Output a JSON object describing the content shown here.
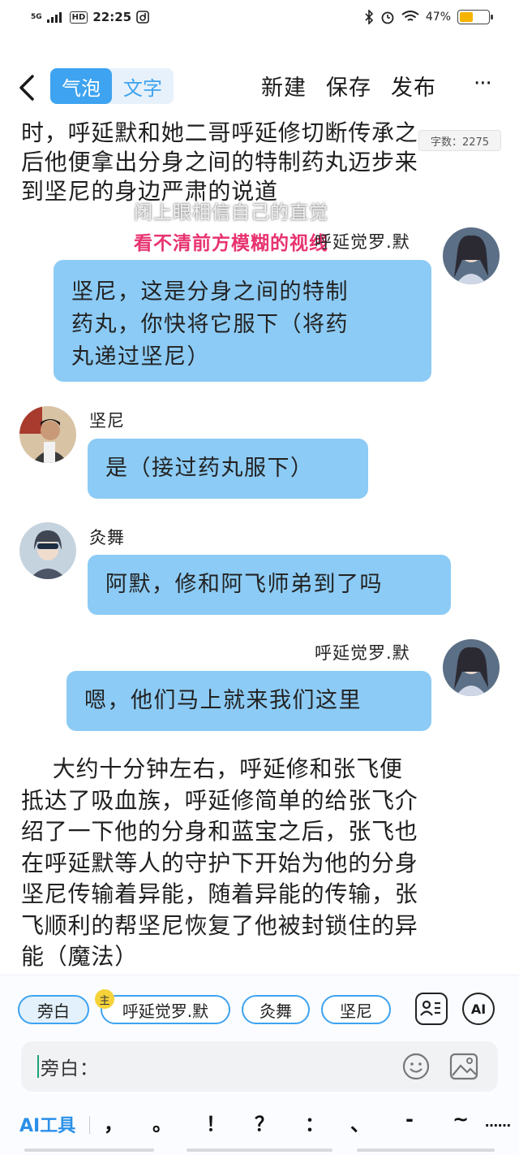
{
  "status": {
    "network": "5G",
    "hd": "HD",
    "time": "22:25",
    "battery_text": "47%",
    "battery_level": 0.47
  },
  "toolbar": {
    "mode_bubble": "气泡",
    "mode_text": "文字",
    "new_label": "新建",
    "save_label": "保存",
    "publish_label": "发布",
    "more_label": "···"
  },
  "story": {
    "narration_top_lines": [
      "时，呼延默和她二哥呼延修切断传承之",
      "后他便拿出分身之间的特制药丸迈步来",
      "到坚尼的身边严肃的说道"
    ],
    "char_count": "字数：2275",
    "lyrics": [
      "闭上眼相信自己的直觉",
      "看不清前方模糊的视线"
    ],
    "messages": [
      {
        "speaker": "呼延觉罗.默",
        "text_lines": [
          "坚尼，这是分身之间的特制",
          "药丸，你快将它服下（将药",
          "丸递过坚尼）"
        ]
      },
      {
        "speaker": "坚尼",
        "text_lines": [
          "是（接过药丸服下）"
        ]
      },
      {
        "speaker": "灸舞",
        "text_lines": [
          "阿默，修和阿飞师弟到了吗"
        ]
      },
      {
        "speaker": "呼延觉罗.默",
        "text_lines": [
          "嗯，他们马上就来我们这里"
        ]
      }
    ],
    "narration_bottom_lines": [
      "    大约十分钟左右，呼延修和张飞便",
      "抵达了吸血族，呼延修简单的给张飞介",
      "绍了一下他的分身和蓝宝之后，张飞也",
      "在呼延默等人的守护下开始为他的分身",
      "坚尼传输着异能，随着异能的传输，张",
      "飞顺利的帮坚尼恢复了他被封锁住的异",
      "能（魔法）"
    ]
  },
  "roles": {
    "chips": [
      "旁白",
      "呼延觉罗.默",
      "灸舞",
      "坚尼"
    ],
    "main_badge": "主",
    "ai_label": "AI"
  },
  "input": {
    "value": "旁白："
  },
  "tools": {
    "ai_tool_label": "AI工具",
    "punctuation": [
      "，",
      "。",
      "！",
      "？",
      "：",
      "、",
      "-",
      "~",
      "……"
    ]
  },
  "colors": {
    "accent": "#3ea3f0",
    "bubble": "#8ccbf5",
    "lyric_pink": "#e8336f"
  }
}
